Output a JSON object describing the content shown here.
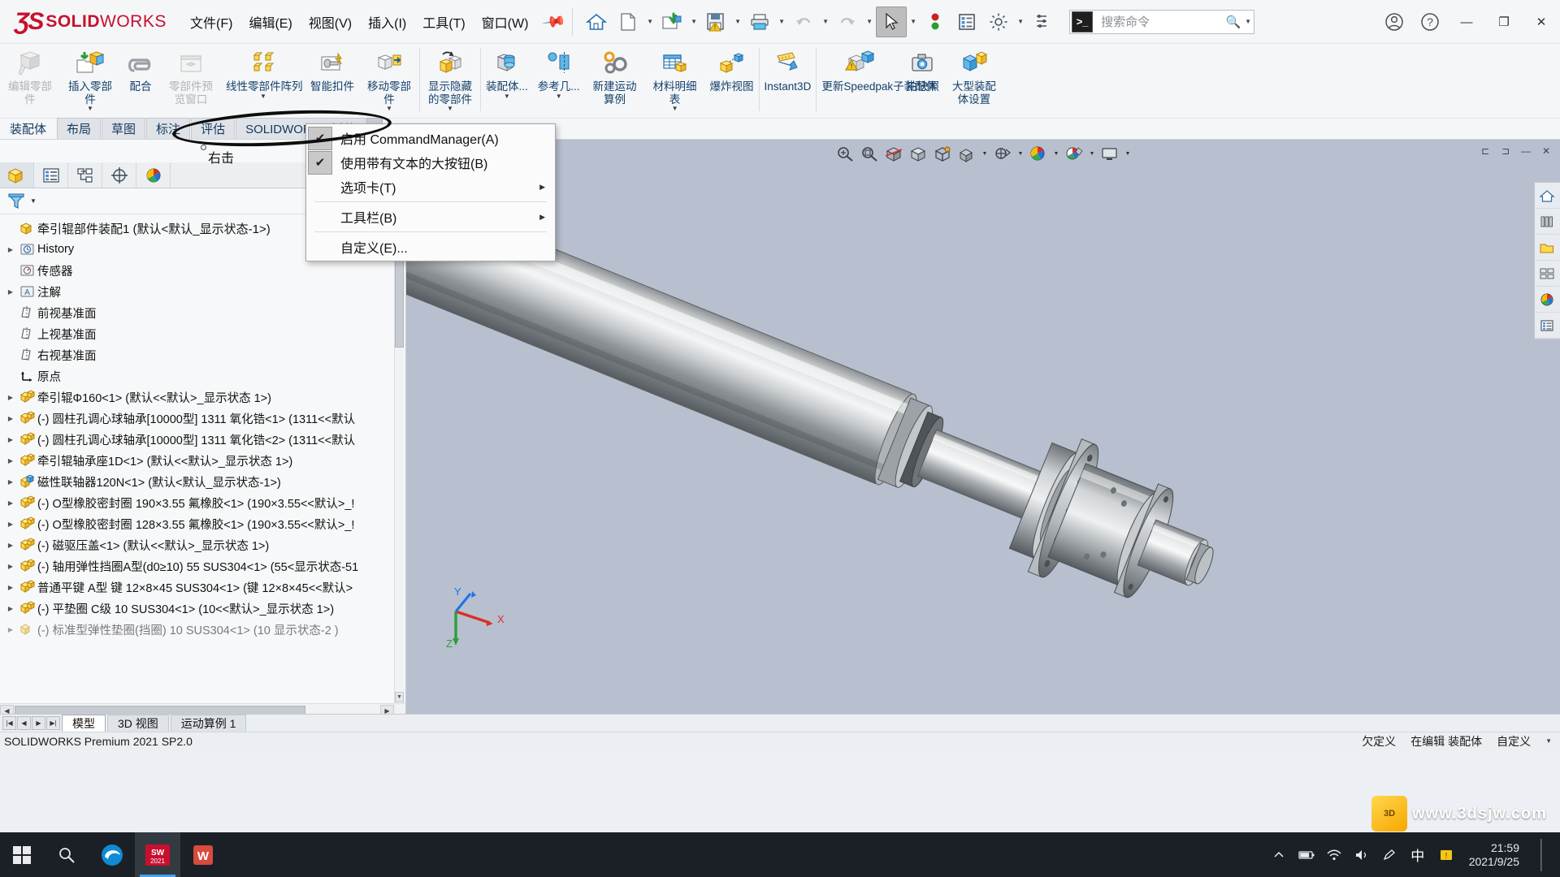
{
  "app": {
    "brand": "SOLIDWORKS",
    "brand_mark": "3S",
    "title_bar_search_placeholder": "搜索命令"
  },
  "menubar": {
    "items": [
      {
        "label": "文件(F)",
        "name": "menu-file"
      },
      {
        "label": "编辑(E)",
        "name": "menu-edit"
      },
      {
        "label": "视图(V)",
        "name": "menu-view"
      },
      {
        "label": "插入(I)",
        "name": "menu-insert"
      },
      {
        "label": "工具(T)",
        "name": "menu-tools"
      },
      {
        "label": "窗口(W)",
        "name": "menu-window"
      }
    ],
    "pin_icon": "pin-icon"
  },
  "quick_access": [
    {
      "name": "home-icon",
      "label": "主页"
    },
    {
      "name": "new-document-icon",
      "label": "新建"
    },
    {
      "name": "open-document-icon",
      "label": "打开"
    },
    {
      "name": "save-icon",
      "label": "保存"
    },
    {
      "name": "print-icon",
      "label": "打印"
    },
    {
      "name": "undo-icon",
      "label": "撤消"
    },
    {
      "name": "redo-icon",
      "label": "重做"
    },
    {
      "name": "select-arrow-icon",
      "label": "选择"
    },
    {
      "name": "rebuild-icon",
      "label": "重建模型"
    },
    {
      "name": "display-list-icon",
      "label": "文件属性"
    },
    {
      "name": "options-gear-icon",
      "label": "选项"
    },
    {
      "name": "customize-icon",
      "label": "自定义"
    }
  ],
  "window_controls": {
    "account": "account-icon",
    "help": "help-icon",
    "minimize": "—",
    "restore": "❐",
    "close": "✕"
  },
  "ribbon": {
    "buttons": [
      {
        "label": "编辑零部件",
        "name": "ribbon-edit-component",
        "disabled": true,
        "icon": "edit-component-icon",
        "dropdown": false
      },
      {
        "label": "插入零部件",
        "name": "ribbon-insert-component",
        "disabled": false,
        "icon": "insert-component-icon",
        "dropdown": true
      },
      {
        "label": "配合",
        "name": "ribbon-mate",
        "disabled": false,
        "icon": "mate-icon",
        "dropdown": false
      },
      {
        "label": "零部件预览窗口",
        "name": "ribbon-component-preview",
        "disabled": true,
        "icon": "component-preview-icon",
        "dropdown": false
      },
      {
        "label": "线性零部件阵列",
        "name": "ribbon-linear-pattern",
        "disabled": false,
        "icon": "linear-pattern-icon",
        "dropdown": true
      },
      {
        "label": "智能扣件",
        "name": "ribbon-smart-fasteners",
        "disabled": false,
        "icon": "smart-fastener-icon",
        "dropdown": false
      },
      {
        "label": "移动零部件",
        "name": "ribbon-move-component",
        "disabled": false,
        "icon": "move-component-icon",
        "dropdown": true
      },
      {
        "label": "显示隐藏的零部件",
        "name": "ribbon-show-hidden-components",
        "disabled": false,
        "icon": "show-hidden-icon",
        "dropdown": true
      },
      {
        "label": "装配体...",
        "name": "ribbon-assembly-features",
        "disabled": false,
        "icon": "assembly-feature-icon",
        "dropdown": true
      },
      {
        "label": "参考几...",
        "name": "ribbon-reference-geometry",
        "disabled": false,
        "icon": "reference-geometry-icon",
        "dropdown": true
      },
      {
        "label": "新建运动算例",
        "name": "ribbon-new-motion-study",
        "disabled": false,
        "icon": "motion-study-icon",
        "dropdown": false
      },
      {
        "label": "材料明细表",
        "name": "ribbon-bom",
        "disabled": false,
        "icon": "bom-icon",
        "dropdown": true
      },
      {
        "label": "爆炸视图",
        "name": "ribbon-exploded-view",
        "disabled": false,
        "icon": "exploded-view-icon",
        "dropdown": false
      },
      {
        "label": "Instant3D",
        "name": "ribbon-instant3d",
        "disabled": false,
        "icon": "instant3d-icon",
        "dropdown": false
      },
      {
        "label": "更新Speedpak子装配体",
        "name": "ribbon-update-speedpak",
        "disabled": false,
        "icon": "update-speedpak-icon",
        "dropdown": false
      },
      {
        "label": "拍快照",
        "name": "ribbon-take-snapshot",
        "disabled": false,
        "icon": "snapshot-icon",
        "dropdown": false
      },
      {
        "label": "大型装配体设置",
        "name": "ribbon-large-assembly-settings",
        "disabled": false,
        "icon": "large-assembly-icon",
        "dropdown": false
      }
    ]
  },
  "feature_tabs": {
    "items": [
      {
        "label": "装配体",
        "active": false,
        "name": "tab-assembly"
      },
      {
        "label": "布局",
        "active": false,
        "name": "tab-layout"
      },
      {
        "label": "草图",
        "active": false,
        "name": "tab-sketch"
      },
      {
        "label": "标注",
        "active": false,
        "name": "tab-markup"
      },
      {
        "label": "评估",
        "active": false,
        "name": "tab-evaluate"
      },
      {
        "label": "SOLIDWORKS 插件",
        "active": false,
        "name": "tab-solidworks-addins"
      }
    ]
  },
  "context_menu": {
    "items": [
      {
        "label": "启用 CommandManager(A)",
        "checked": true,
        "submenu": false,
        "name": "ctx-enable-commandmanager"
      },
      {
        "label": "使用带有文本的大按钮(B)",
        "checked": true,
        "submenu": false,
        "name": "ctx-use-large-buttons-with-text"
      },
      {
        "label": "选项卡(T)",
        "checked": false,
        "submenu": true,
        "name": "ctx-tabs"
      },
      {
        "label": "工具栏(B)",
        "checked": false,
        "submenu": true,
        "name": "ctx-toolbars"
      },
      {
        "label": "自定义(E)...",
        "checked": false,
        "submenu": false,
        "name": "ctx-customize"
      }
    ],
    "check_glyph": "✔",
    "submenu_glyph": "▶"
  },
  "annotation": {
    "right_click_label": "右击"
  },
  "panel_tabs": [
    {
      "name": "ptab-feature-manager",
      "icon": "feature-tree-icon",
      "active": true
    },
    {
      "name": "ptab-property-manager",
      "icon": "property-manager-icon",
      "active": false
    },
    {
      "name": "ptab-configuration-manager",
      "icon": "configuration-icon",
      "active": false
    },
    {
      "name": "ptab-dimxpert-manager",
      "icon": "dimxpert-icon",
      "active": false
    },
    {
      "name": "ptab-display-manager",
      "icon": "display-manager-icon",
      "active": false
    }
  ],
  "filter": {
    "icon": "filter-funnel-icon",
    "name": "tree-filter"
  },
  "tree": {
    "root": {
      "label": "牵引辊部件装配1  (默认<默认_显示状态-1>)",
      "icon": "assembly-icon"
    },
    "items": [
      {
        "label": "History",
        "icon": "history-folder-icon",
        "arrow": true,
        "indent": 1
      },
      {
        "label": "传感器",
        "icon": "sensor-folder-icon",
        "arrow": false,
        "indent": 1
      },
      {
        "label": "注解",
        "icon": "annotation-folder-icon",
        "arrow": true,
        "indent": 1
      },
      {
        "label": "前视基准面",
        "icon": "plane-icon",
        "arrow": false,
        "indent": 1
      },
      {
        "label": "上视基准面",
        "icon": "plane-icon",
        "arrow": false,
        "indent": 1
      },
      {
        "label": "右视基准面",
        "icon": "plane-icon",
        "arrow": false,
        "indent": 1
      },
      {
        "label": "原点",
        "icon": "origin-icon",
        "arrow": false,
        "indent": 1
      },
      {
        "label": "牵引辊Φ160<1>  (默认<<默认>_显示状态 1>)",
        "icon": "part-icon",
        "arrow": true,
        "indent": 1
      },
      {
        "label": "(-) 圆柱孔调心球轴承[10000型] 1311 氧化锆<1>  (1311<<默认",
        "icon": "part-icon",
        "arrow": true,
        "indent": 1
      },
      {
        "label": "(-) 圆柱孔调心球轴承[10000型] 1311 氧化锆<2>  (1311<<默认",
        "icon": "part-icon",
        "arrow": true,
        "indent": 1
      },
      {
        "label": "牵引辊轴承座1D<1>  (默认<<默认>_显示状态 1>)",
        "icon": "part-icon",
        "arrow": true,
        "indent": 1
      },
      {
        "label": "磁性联轴器120N<1>  (默认<默认_显示状态-1>)",
        "icon": "subassembly-icon",
        "arrow": true,
        "indent": 1
      },
      {
        "label": "(-) O型橡胶密封圈 190×3.55 氟橡胶<1>  (190×3.55<<默认>_!",
        "icon": "part-icon",
        "arrow": true,
        "indent": 1
      },
      {
        "label": "(-) O型橡胶密封圈 128×3.55 氟橡胶<1>  (190×3.55<<默认>_!",
        "icon": "part-icon",
        "arrow": true,
        "indent": 1
      },
      {
        "label": "(-) 磁驱压盖<1>  (默认<<默认>_显示状态 1>)",
        "icon": "part-icon",
        "arrow": true,
        "indent": 1
      },
      {
        "label": "(-) 轴用弹性挡圈A型(d0≥10) 55 SUS304<1>  (55<显示状态-51",
        "icon": "part-icon",
        "arrow": true,
        "indent": 1
      },
      {
        "label": "普通平键 A型 键 12×8×45 SUS304<1>  (键 12×8×45<<默认>",
        "icon": "part-icon",
        "arrow": true,
        "indent": 1
      },
      {
        "label": "(-) 平垫圈 C级 10 SUS304<1>  (10<<默认>_显示状态 1>)",
        "icon": "part-icon",
        "arrow": true,
        "indent": 1
      },
      {
        "label": "(-) 标准型弹性垫圈(挡圈) 10 SUS304<1>  (10  显示状态-2 )",
        "icon": "part-icon",
        "arrow": true,
        "indent": 1
      }
    ]
  },
  "viewport": {
    "toolbar": [
      {
        "name": "zoom-to-fit-icon"
      },
      {
        "name": "zoom-to-area-icon"
      },
      {
        "name": "section-view-icon"
      },
      {
        "name": "view-orientation-icon"
      },
      {
        "name": "display-style-icon"
      },
      {
        "name": "hide-show-items-icon"
      },
      {
        "name": "edit-appearance-icon"
      },
      {
        "name": "apply-scene-icon"
      },
      {
        "name": "view-settings-icon"
      }
    ],
    "window_buttons": [
      "restore-down-icon",
      "maximize-icon",
      "minimize-icon",
      "close-view-icon"
    ],
    "right_dock": [
      {
        "name": "dock-home-icon"
      },
      {
        "name": "dock-design-library-icon"
      },
      {
        "name": "dock-file-explorer-icon"
      },
      {
        "name": "dock-view-palette-icon"
      },
      {
        "name": "dock-appearances-icon"
      },
      {
        "name": "dock-custom-properties-icon"
      }
    ],
    "triad": {
      "x": "X",
      "y": "Y",
      "z": "Z"
    }
  },
  "bottom_tabs": {
    "nav": [
      "|◀",
      "◀",
      "▶",
      "▶|"
    ],
    "items": [
      {
        "label": "模型",
        "active": true,
        "name": "btab-model"
      },
      {
        "label": "3D 视图",
        "active": false,
        "name": "btab-3d-views"
      },
      {
        "label": "运动算例 1",
        "active": false,
        "name": "btab-motion-study-1"
      }
    ]
  },
  "status_bar": {
    "left": "SOLIDWORKS Premium 2021 SP2.0",
    "under_defined": "欠定义",
    "editing": "在编辑 装配体",
    "custom": "自定义"
  },
  "taskbar": {
    "start": "start-icon",
    "search": "search-icon",
    "apps": [
      {
        "name": "taskbar-edge",
        "label": "e"
      },
      {
        "name": "taskbar-solidworks",
        "label": "SW 2021"
      },
      {
        "name": "taskbar-wps",
        "label": "W"
      }
    ],
    "tray": [
      {
        "name": "tray-chevron-up-icon",
        "label": "︿"
      },
      {
        "name": "tray-battery-icon",
        "label": "▭"
      },
      {
        "name": "tray-wifi-icon",
        "label": "◞"
      },
      {
        "name": "tray-volume-icon",
        "label": "🔊"
      },
      {
        "name": "tray-input-icon",
        "label": "✎"
      },
      {
        "name": "tray-ime-icon",
        "label": "中"
      },
      {
        "name": "tray-notification-icon",
        "label": "▣"
      }
    ],
    "clock_time": "21:59",
    "clock_date": "2021/9/25"
  },
  "watermark": {
    "text": "www.3dsjw.com",
    "logo": "3D"
  },
  "colors": {
    "brand_red": "#c8102e",
    "ribbon_bg": "#f4f6f8",
    "viewport_bg": "#b8c0cf",
    "label_blue": "#16406b",
    "taskbar": "#1b2026"
  }
}
